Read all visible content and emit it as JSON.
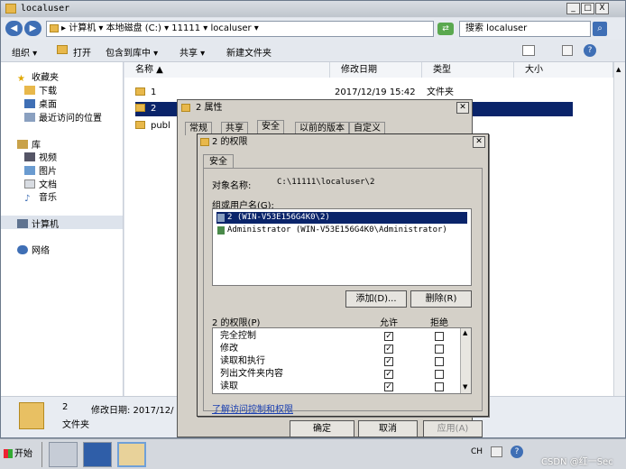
{
  "window": {
    "title": "localuser",
    "controls": [
      "_",
      "□",
      "X"
    ]
  },
  "address": {
    "path": "▸ 计算机 ▾ 本地磁盘 (C:) ▾ 11111 ▾ localuser ▾",
    "search_placeholder": "搜索 localuser"
  },
  "toolbar": {
    "organize": "组织 ▾",
    "open": "打开",
    "include": "包含到库中 ▾",
    "share": "共享 ▾",
    "new_folder": "新建文件夹"
  },
  "sidebar": {
    "favorites": "收藏夹",
    "downloads": "下载",
    "desktop": "桌面",
    "recent": "最近访问的位置",
    "libraries": "库",
    "videos": "视频",
    "pictures": "图片",
    "documents": "文档",
    "music": "音乐",
    "computer": "计算机",
    "network": "网络"
  },
  "columns": {
    "name": "名称 ▲",
    "date": "修改日期",
    "type": "类型",
    "size": "大小"
  },
  "files": [
    {
      "name": "1",
      "date": "2017/12/19 15:42",
      "type": "文件夹"
    },
    {
      "name": "2",
      "date": "",
      "type": ""
    },
    {
      "name": "publ",
      "date": "",
      "type": ""
    }
  ],
  "details": {
    "name": "2",
    "modified": "修改日期: 2017/12/",
    "type": "文件夹"
  },
  "taskbar": {
    "start": "开始",
    "tray": [
      "CH",
      "?"
    ]
  },
  "props_dialog": {
    "title": "2 属性",
    "tabs": [
      "常规",
      "共享",
      "安全",
      "以前的版本",
      "自定义"
    ],
    "ok": "确定",
    "cancel": "取消",
    "apply": "应用(A)"
  },
  "perm_dialog": {
    "title": "2 的权限",
    "tab": "安全",
    "object_label": "对象名称:",
    "object_value": "C:\\11111\\localuser\\2",
    "group_label": "组或用户名(G):",
    "groups": [
      "2 (WIN-V53E156G4K0\\2)",
      "Administrator (WIN-V53E156G4K0\\Administrator)"
    ],
    "add_btn": "添加(D)...",
    "remove_btn": "删除(R)",
    "perm_label": "2 的权限(P)",
    "allow": "允许",
    "deny": "拒绝",
    "permissions": [
      {
        "name": "完全控制",
        "allow": true,
        "deny": false
      },
      {
        "name": "修改",
        "allow": true,
        "deny": false
      },
      {
        "name": "读取和执行",
        "allow": true,
        "deny": false
      },
      {
        "name": "列出文件夹内容",
        "allow": true,
        "deny": false
      },
      {
        "name": "读取",
        "allow": true,
        "deny": false
      }
    ],
    "learn_link": "了解访问控制和权限"
  },
  "watermark": "CSDN @红一Sec",
  "colors": {
    "selection": "#0a246a",
    "link": "#1a3fb0",
    "folder": "#e8b84b"
  }
}
